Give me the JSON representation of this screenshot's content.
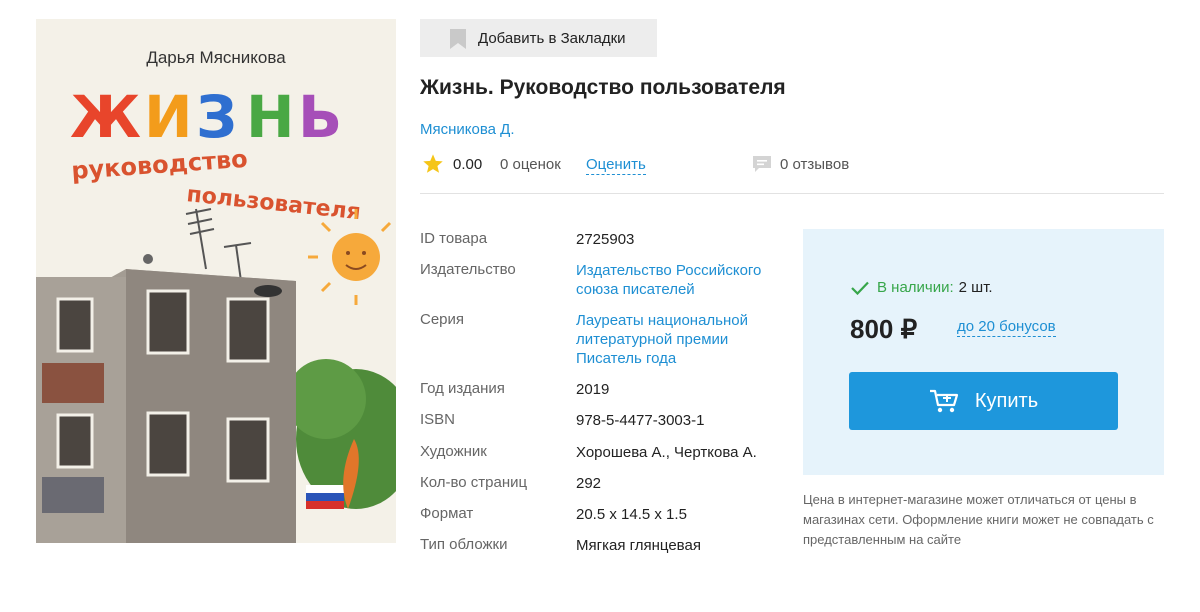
{
  "cover": {
    "author": "Дарья Мясникова",
    "title_big": "ЖИЗНЬ",
    "subtitle_1": "руководство",
    "subtitle_2": "пользователя"
  },
  "bookmark": {
    "label": "Добавить в Закладки",
    "icon": "bookmark-icon"
  },
  "product": {
    "title": "Жизнь. Руководство пользователя",
    "author": "Мясникова Д."
  },
  "rating": {
    "value": "0.00",
    "votes": "0 оценок",
    "rate_link": "Оценить",
    "reviews": "0 отзывов",
    "star_color": "#f5c518"
  },
  "properties": [
    {
      "key": "ID товара",
      "value": "2725903",
      "link": false
    },
    {
      "key": "Издательство",
      "value": "Издательство Российского союза писателей",
      "link": true
    },
    {
      "key": "Серия",
      "value": "Лауреаты национальной литературной премии Писатель года",
      "link": true
    },
    {
      "key": "Год издания",
      "value": "2019",
      "link": false
    },
    {
      "key": "ISBN",
      "value": "978-5-4477-3003-1",
      "link": false
    },
    {
      "key": "Художник",
      "value": "Хорошева А., Черткова А.",
      "link": false
    },
    {
      "key": "Кол-во страниц",
      "value": "292",
      "link": false
    },
    {
      "key": "Формат",
      "value": "20.5 x 14.5 x 1.5",
      "link": false
    },
    {
      "key": "Тип обложки",
      "value": "Мягкая глянцевая",
      "link": false
    }
  ],
  "buy": {
    "stock_label": "В наличии:",
    "stock_qty": "2 шт.",
    "price": "800 ₽",
    "bonus": "до 20 бонусов",
    "button": "Купить",
    "accent": "#1e97dc",
    "stock_color": "#37a64a"
  },
  "note": "Цена в интернет-магазине может отличаться от цены в магазинах сети. Оформление книги может не совпадать с представленным на сайте"
}
